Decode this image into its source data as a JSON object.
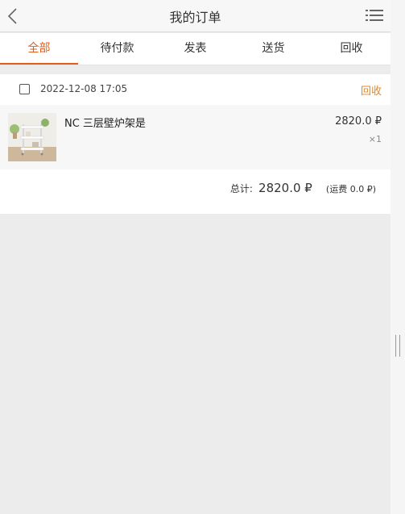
{
  "header": {
    "title": "我的订单",
    "back_icon": "chevron-left-icon",
    "menu_icon": "list-menu-icon"
  },
  "tabs": [
    {
      "label": "全部",
      "active": true
    },
    {
      "label": "待付款",
      "active": false
    },
    {
      "label": "发表",
      "active": false
    },
    {
      "label": "送货",
      "active": false
    },
    {
      "label": "回收",
      "active": false
    }
  ],
  "order": {
    "date": "2022-12-08 17:05",
    "status": "回收",
    "item": {
      "name": "NC 三层壁炉架是",
      "price": "2820.0 ₽",
      "qty": "×1"
    },
    "total": {
      "label": "总计:",
      "amount": "2820.0 ₽",
      "shipping": "(运费 0.0 ₽)"
    }
  },
  "colors": {
    "accent": "#e05d1c",
    "status": "#e08a2c",
    "background": "#ececec"
  }
}
